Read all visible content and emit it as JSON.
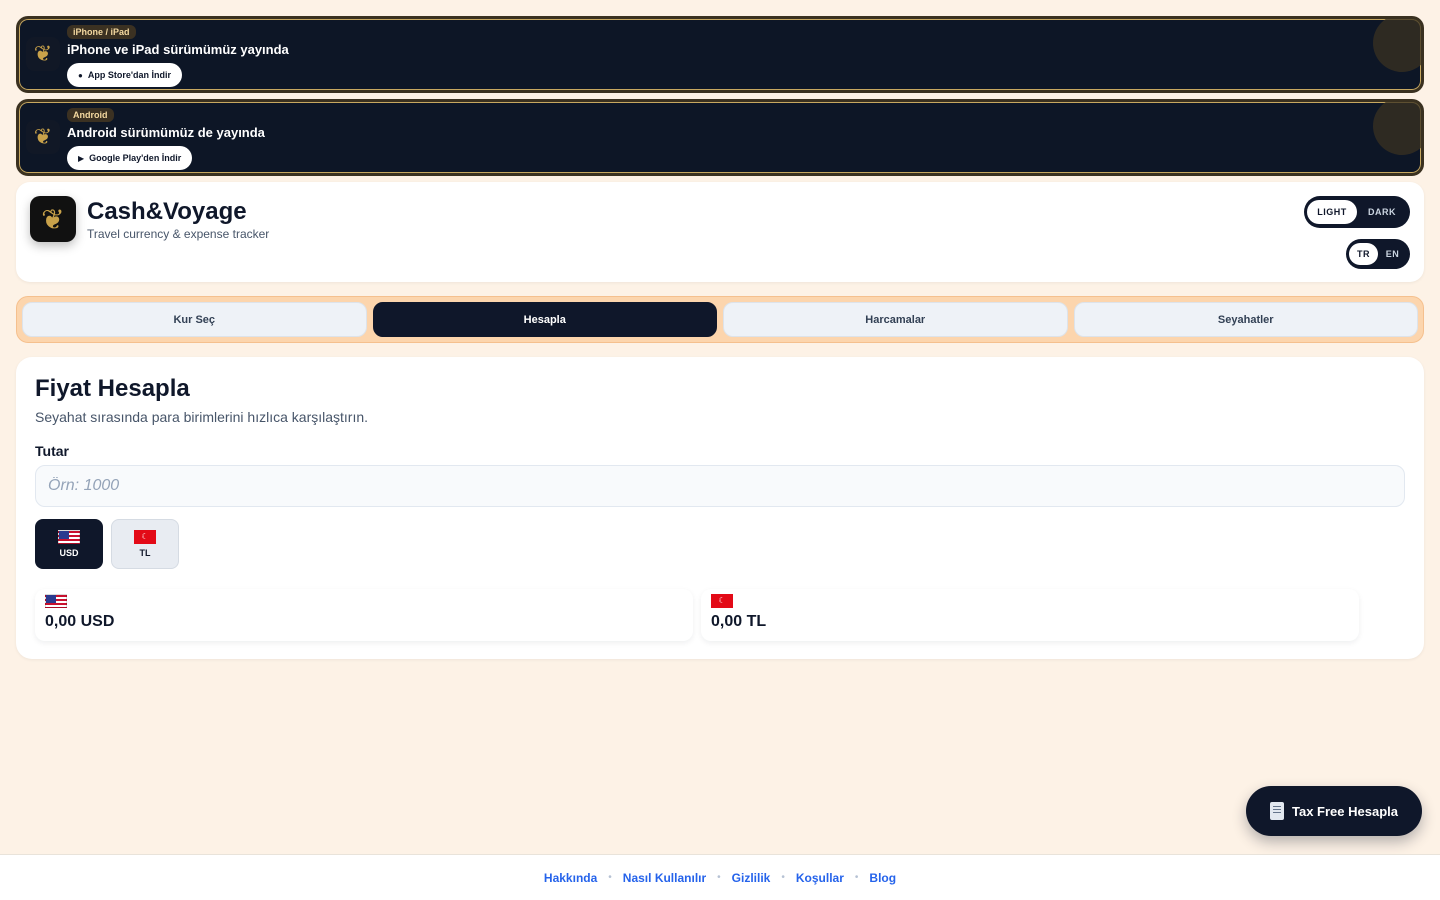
{
  "banners": [
    {
      "pill": "iPhone / iPad",
      "title": "iPhone ve iPad sürümümüz yayında",
      "button_icon": "",
      "button_label": "App Store'dan İndir"
    },
    {
      "pill": "Android",
      "title": "Android sürümümüz de yayında",
      "button_icon": "▶",
      "button_label": "Google Play'den İndir"
    }
  ],
  "header": {
    "app_name": "Cash&Voyage",
    "tagline": "Travel currency & expense tracker",
    "theme_options": [
      "LIGHT",
      "DARK"
    ],
    "theme_selected": "LIGHT",
    "lang_options": [
      "TR",
      "EN"
    ],
    "lang_selected": "TR"
  },
  "tabs": [
    {
      "label": "Kur Seç",
      "active": false
    },
    {
      "label": "Hesapla",
      "active": true
    },
    {
      "label": "Harcamalar",
      "active": false
    },
    {
      "label": "Seyahatler",
      "active": false
    }
  ],
  "calculator": {
    "title": "Fiyat Hesapla",
    "subtitle": "Seyahat sırasında para birimlerini hızlıca karşılaştırın.",
    "amount_label": "Tutar",
    "amount_placeholder": "Örn: 1000",
    "amount_value": "",
    "currencies": [
      {
        "code": "USD",
        "selected": true
      },
      {
        "code": "TL",
        "selected": false
      }
    ],
    "results": [
      {
        "value": "0,00 USD"
      },
      {
        "value": "0,00 TL"
      }
    ]
  },
  "floating": {
    "taxfree_label": "Tax Free Hesapla"
  },
  "footer": {
    "links": [
      "Hakkında",
      "Nasıl Kullanılır",
      "Gizlilik",
      "Koşullar",
      "Blog"
    ]
  },
  "colors": {
    "background": "#fdf2e6",
    "navy": "#0f172a",
    "tabs_bg": "#fcd5ad",
    "link": "#2563eb",
    "gold": "#c9a24a"
  }
}
